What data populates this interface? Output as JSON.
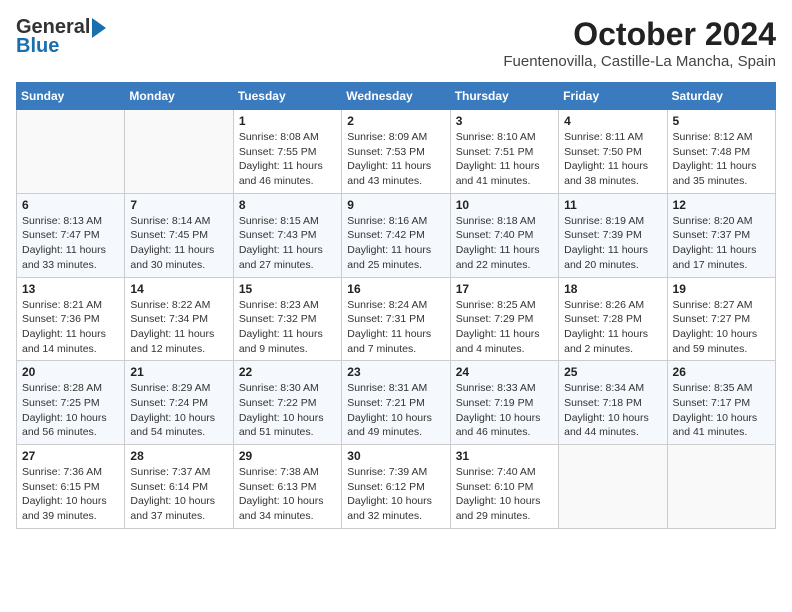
{
  "logo": {
    "line1": "General",
    "line2": "Blue"
  },
  "title": "October 2024",
  "subtitle": "Fuentenovilla, Castille-La Mancha, Spain",
  "days_of_week": [
    "Sunday",
    "Monday",
    "Tuesday",
    "Wednesday",
    "Thursday",
    "Friday",
    "Saturday"
  ],
  "weeks": [
    [
      {
        "day": "",
        "info": ""
      },
      {
        "day": "",
        "info": ""
      },
      {
        "day": "1",
        "info": "Sunrise: 8:08 AM\nSunset: 7:55 PM\nDaylight: 11 hours and 46 minutes."
      },
      {
        "day": "2",
        "info": "Sunrise: 8:09 AM\nSunset: 7:53 PM\nDaylight: 11 hours and 43 minutes."
      },
      {
        "day": "3",
        "info": "Sunrise: 8:10 AM\nSunset: 7:51 PM\nDaylight: 11 hours and 41 minutes."
      },
      {
        "day": "4",
        "info": "Sunrise: 8:11 AM\nSunset: 7:50 PM\nDaylight: 11 hours and 38 minutes."
      },
      {
        "day": "5",
        "info": "Sunrise: 8:12 AM\nSunset: 7:48 PM\nDaylight: 11 hours and 35 minutes."
      }
    ],
    [
      {
        "day": "6",
        "info": "Sunrise: 8:13 AM\nSunset: 7:47 PM\nDaylight: 11 hours and 33 minutes."
      },
      {
        "day": "7",
        "info": "Sunrise: 8:14 AM\nSunset: 7:45 PM\nDaylight: 11 hours and 30 minutes."
      },
      {
        "day": "8",
        "info": "Sunrise: 8:15 AM\nSunset: 7:43 PM\nDaylight: 11 hours and 27 minutes."
      },
      {
        "day": "9",
        "info": "Sunrise: 8:16 AM\nSunset: 7:42 PM\nDaylight: 11 hours and 25 minutes."
      },
      {
        "day": "10",
        "info": "Sunrise: 8:18 AM\nSunset: 7:40 PM\nDaylight: 11 hours and 22 minutes."
      },
      {
        "day": "11",
        "info": "Sunrise: 8:19 AM\nSunset: 7:39 PM\nDaylight: 11 hours and 20 minutes."
      },
      {
        "day": "12",
        "info": "Sunrise: 8:20 AM\nSunset: 7:37 PM\nDaylight: 11 hours and 17 minutes."
      }
    ],
    [
      {
        "day": "13",
        "info": "Sunrise: 8:21 AM\nSunset: 7:36 PM\nDaylight: 11 hours and 14 minutes."
      },
      {
        "day": "14",
        "info": "Sunrise: 8:22 AM\nSunset: 7:34 PM\nDaylight: 11 hours and 12 minutes."
      },
      {
        "day": "15",
        "info": "Sunrise: 8:23 AM\nSunset: 7:32 PM\nDaylight: 11 hours and 9 minutes."
      },
      {
        "day": "16",
        "info": "Sunrise: 8:24 AM\nSunset: 7:31 PM\nDaylight: 11 hours and 7 minutes."
      },
      {
        "day": "17",
        "info": "Sunrise: 8:25 AM\nSunset: 7:29 PM\nDaylight: 11 hours and 4 minutes."
      },
      {
        "day": "18",
        "info": "Sunrise: 8:26 AM\nSunset: 7:28 PM\nDaylight: 11 hours and 2 minutes."
      },
      {
        "day": "19",
        "info": "Sunrise: 8:27 AM\nSunset: 7:27 PM\nDaylight: 10 hours and 59 minutes."
      }
    ],
    [
      {
        "day": "20",
        "info": "Sunrise: 8:28 AM\nSunset: 7:25 PM\nDaylight: 10 hours and 56 minutes."
      },
      {
        "day": "21",
        "info": "Sunrise: 8:29 AM\nSunset: 7:24 PM\nDaylight: 10 hours and 54 minutes."
      },
      {
        "day": "22",
        "info": "Sunrise: 8:30 AM\nSunset: 7:22 PM\nDaylight: 10 hours and 51 minutes."
      },
      {
        "day": "23",
        "info": "Sunrise: 8:31 AM\nSunset: 7:21 PM\nDaylight: 10 hours and 49 minutes."
      },
      {
        "day": "24",
        "info": "Sunrise: 8:33 AM\nSunset: 7:19 PM\nDaylight: 10 hours and 46 minutes."
      },
      {
        "day": "25",
        "info": "Sunrise: 8:34 AM\nSunset: 7:18 PM\nDaylight: 10 hours and 44 minutes."
      },
      {
        "day": "26",
        "info": "Sunrise: 8:35 AM\nSunset: 7:17 PM\nDaylight: 10 hours and 41 minutes."
      }
    ],
    [
      {
        "day": "27",
        "info": "Sunrise: 7:36 AM\nSunset: 6:15 PM\nDaylight: 10 hours and 39 minutes."
      },
      {
        "day": "28",
        "info": "Sunrise: 7:37 AM\nSunset: 6:14 PM\nDaylight: 10 hours and 37 minutes."
      },
      {
        "day": "29",
        "info": "Sunrise: 7:38 AM\nSunset: 6:13 PM\nDaylight: 10 hours and 34 minutes."
      },
      {
        "day": "30",
        "info": "Sunrise: 7:39 AM\nSunset: 6:12 PM\nDaylight: 10 hours and 32 minutes."
      },
      {
        "day": "31",
        "info": "Sunrise: 7:40 AM\nSunset: 6:10 PM\nDaylight: 10 hours and 29 minutes."
      },
      {
        "day": "",
        "info": ""
      },
      {
        "day": "",
        "info": ""
      }
    ]
  ]
}
